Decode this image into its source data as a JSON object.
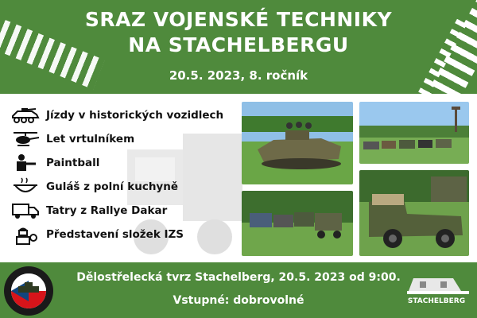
{
  "header": {
    "title_line1": "SRAZ VOJENSKÉ TECHNIKY",
    "title_line2": "NA STACHELBERGU",
    "date": "20.5. 2023, 8. ročník"
  },
  "features": [
    {
      "label": "Jízdy v historických vozidlech",
      "icon": "armored-vehicle-icon"
    },
    {
      "label": "Let vrtulníkem",
      "icon": "helicopter-icon"
    },
    {
      "label": "Paintball",
      "icon": "paintball-player-icon"
    },
    {
      "label": "Guláš z polní kuchyně",
      "icon": "goulash-pot-icon"
    },
    {
      "label": "Tatry z Rallye Dakar",
      "icon": "truck-icon"
    },
    {
      "label": "Představení složek IZS",
      "icon": "firefighter-icon"
    }
  ],
  "footer": {
    "line1": "Dělostřelecká tvrz Stachelberg, 20.5. 2023 od 9:00.",
    "line2": "Vstupné: dobrovolné",
    "badge_text": "VOJENSKÁ VOZIDLA TRUTNOV z.s.",
    "fort_name": "STACHELBERG"
  },
  "colors": {
    "brand_green": "#4f8a3c",
    "text_dark": "#111111"
  }
}
